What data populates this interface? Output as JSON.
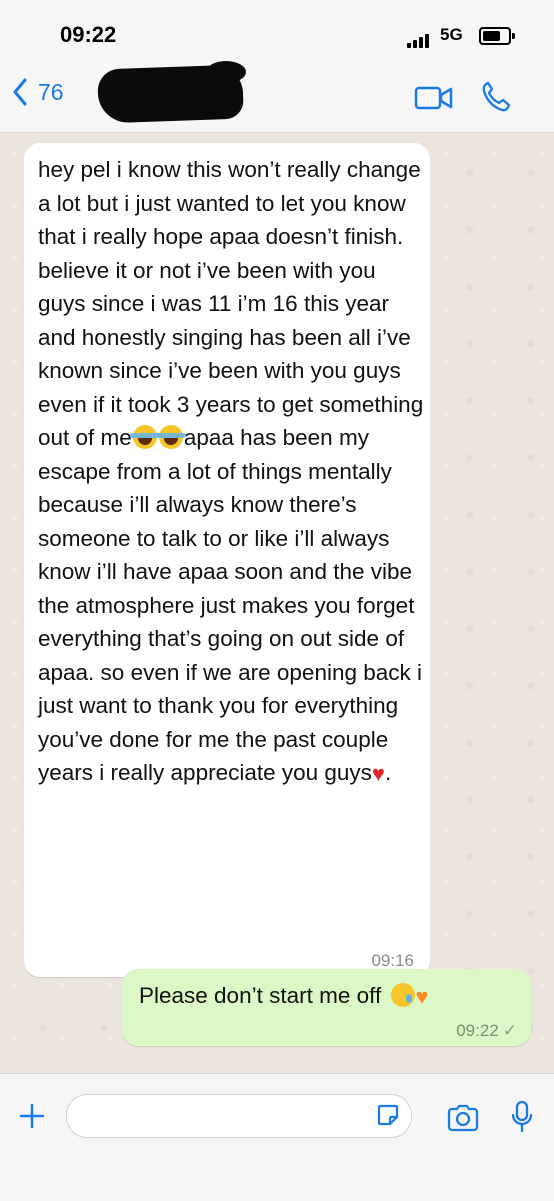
{
  "status_bar": {
    "time": "09:22",
    "network": "5G"
  },
  "header": {
    "back_count": "76",
    "accent_color": "#1a7ae6"
  },
  "messages": [
    {
      "direction": "incoming",
      "text_parts": [
        "hey pel i know this won’t really change a lot but i just wanted to let you know that i really hope apaa doesn’t finish. believe it or not i’ve been with you guys since i was 11 i’m 16 this year and honestly singing has been all i’ve known since i’ve been with you guys even if it took 3 years to get something out of me",
        "apaa has been my escape from a lot of things mentally because i’ll always know there’s someone to talk to or like i’ll always know i’ll have apaa soon and the vibe the atmosphere just makes you forget everything that’s going on out side of apaa. so even if we are opening back i just want to thank you for everything you’ve done for me the past couple years i really appreciate you guys",
        "."
      ],
      "emojis": [
        "face-with-tears-of-joy",
        "face-with-tears-of-joy",
        "red-heart"
      ],
      "time": "09:16"
    },
    {
      "direction": "outgoing",
      "text": "Please don’t start me off",
      "emojis": [
        "smiling-face-with-tear",
        "orange-heart"
      ],
      "time": "09:22",
      "status": "sent-check"
    }
  ],
  "composer": {
    "placeholder": ""
  },
  "colors": {
    "incoming_bubble": "#ffffff",
    "outgoing_bubble": "#dcf8c6",
    "chat_background": "#ece5dd"
  }
}
